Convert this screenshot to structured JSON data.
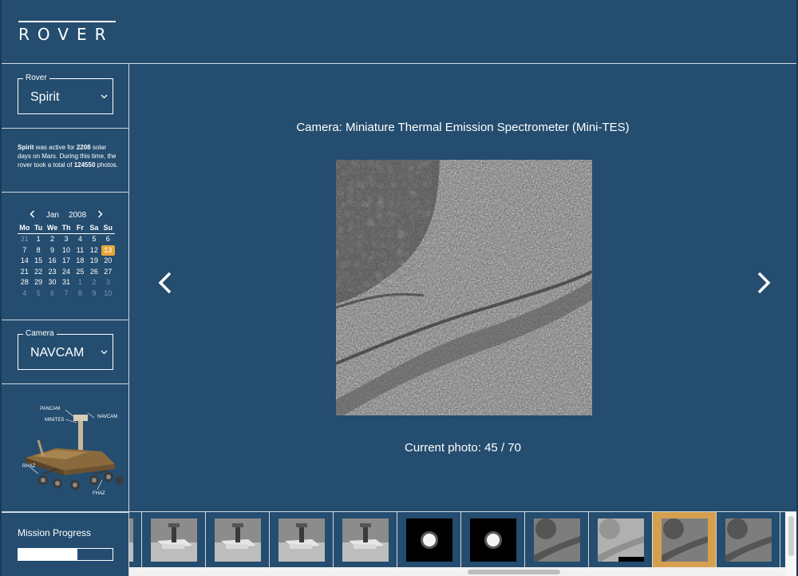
{
  "app": {
    "logo": "ROVER"
  },
  "sidebar": {
    "rover_select": {
      "legend": "Rover",
      "value": "Spirit"
    },
    "info": {
      "rover": "Spirit",
      "t1": " was active for ",
      "days": "2208",
      "t2": " solar days on Mars. During this time, the rover took a total of ",
      "photos": "124550",
      "t3": " photos."
    },
    "calendar": {
      "month": "Jan",
      "year": "2008",
      "prev_icon": "chevron-left-icon",
      "next_icon": "chevron-right-icon",
      "weekdays": [
        "Mo",
        "Tu",
        "We",
        "Th",
        "Fr",
        "Sa",
        "Su"
      ],
      "days": [
        {
          "d": "31",
          "muted": true
        },
        {
          "d": "1"
        },
        {
          "d": "2"
        },
        {
          "d": "3"
        },
        {
          "d": "4"
        },
        {
          "d": "5"
        },
        {
          "d": "6"
        },
        {
          "d": "7"
        },
        {
          "d": "8"
        },
        {
          "d": "9"
        },
        {
          "d": "10"
        },
        {
          "d": "11"
        },
        {
          "d": "12"
        },
        {
          "d": "13",
          "selected": true
        },
        {
          "d": "14"
        },
        {
          "d": "15"
        },
        {
          "d": "16"
        },
        {
          "d": "17"
        },
        {
          "d": "18"
        },
        {
          "d": "19"
        },
        {
          "d": "20"
        },
        {
          "d": "21"
        },
        {
          "d": "22"
        },
        {
          "d": "23"
        },
        {
          "d": "24"
        },
        {
          "d": "25"
        },
        {
          "d": "26"
        },
        {
          "d": "27"
        },
        {
          "d": "28"
        },
        {
          "d": "29"
        },
        {
          "d": "30"
        },
        {
          "d": "31"
        },
        {
          "d": "1",
          "muted": true
        },
        {
          "d": "2",
          "muted": true
        },
        {
          "d": "3",
          "muted": true
        },
        {
          "d": "4",
          "muted": true
        },
        {
          "d": "5",
          "muted": true
        },
        {
          "d": "6",
          "muted": true
        },
        {
          "d": "7",
          "muted": true
        },
        {
          "d": "8",
          "muted": true
        },
        {
          "d": "9",
          "muted": true
        },
        {
          "d": "10",
          "muted": true
        }
      ]
    },
    "camera_select": {
      "legend": "Camera",
      "value": "NAVCAM"
    },
    "diagram_labels": {
      "pancam": "PANCAM",
      "navcam": "NAVCAM",
      "minites": "MINITES",
      "rhaz": "RHAZ",
      "fhaz": "FHAZ"
    },
    "mission": {
      "label": "Mission Progress",
      "progress": 0.63
    }
  },
  "main": {
    "camera_title": "Camera: Miniature Thermal Emission Spectrometer (Mini-TES)",
    "counter": "Current photo: 45 / 70",
    "prev_icon": "chevron-left-icon",
    "next_icon": "chevron-right-icon"
  },
  "thumbnails": [
    {
      "kind": "tool"
    },
    {
      "kind": "tool"
    },
    {
      "kind": "tool"
    },
    {
      "kind": "tool"
    },
    {
      "kind": "tool"
    },
    {
      "kind": "sun"
    },
    {
      "kind": "sun"
    },
    {
      "kind": "rock"
    },
    {
      "kind": "rock-light"
    },
    {
      "kind": "rock",
      "selected": true
    },
    {
      "kind": "rock"
    }
  ],
  "colors": {
    "background": "#244d6f",
    "accent": "#e8a63a",
    "thumb_selected": "#d4a04f"
  }
}
